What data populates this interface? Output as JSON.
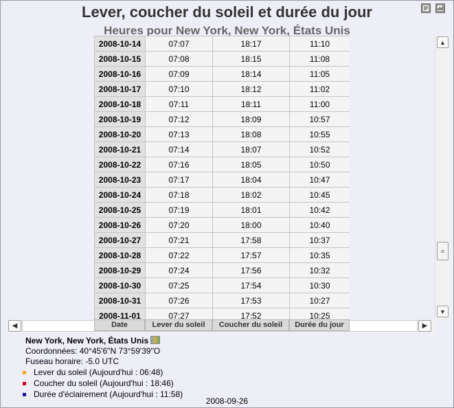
{
  "header": {
    "title": "Lever, coucher du soleil et durée du jour",
    "subtitle": "Heures pour New York, New York, États Unis"
  },
  "toolbar": {
    "icons": [
      "export-icon",
      "chart-icon"
    ]
  },
  "table": {
    "columns": [
      "Date",
      "Lever du soleil",
      "Coucher du soleil",
      "Durée du jour"
    ],
    "rows": [
      [
        "2008-10-14",
        "07:07",
        "18:17",
        "11:10"
      ],
      [
        "2008-10-15",
        "07:08",
        "18:15",
        "11:08"
      ],
      [
        "2008-10-16",
        "07:09",
        "18:14",
        "11:05"
      ],
      [
        "2008-10-17",
        "07:10",
        "18:12",
        "11:02"
      ],
      [
        "2008-10-18",
        "07:11",
        "18:11",
        "11:00"
      ],
      [
        "2008-10-19",
        "07:12",
        "18:09",
        "10:57"
      ],
      [
        "2008-10-20",
        "07:13",
        "18:08",
        "10:55"
      ],
      [
        "2008-10-21",
        "07:14",
        "18:07",
        "10:52"
      ],
      [
        "2008-10-22",
        "07:16",
        "18:05",
        "10:50"
      ],
      [
        "2008-10-23",
        "07:17",
        "18:04",
        "10:47"
      ],
      [
        "2008-10-24",
        "07:18",
        "18:02",
        "10:45"
      ],
      [
        "2008-10-25",
        "07:19",
        "18:01",
        "10:42"
      ],
      [
        "2008-10-26",
        "07:20",
        "18:00",
        "10:40"
      ],
      [
        "2008-10-27",
        "07:21",
        "17:58",
        "10:37"
      ],
      [
        "2008-10-28",
        "07:22",
        "17:57",
        "10:35"
      ],
      [
        "2008-10-29",
        "07:24",
        "17:56",
        "10:32"
      ],
      [
        "2008-10-30",
        "07:25",
        "17:54",
        "10:30"
      ],
      [
        "2008-10-31",
        "07:26",
        "17:53",
        "10:27"
      ],
      [
        "2008-11-01",
        "07:27",
        "17:52",
        "10:25"
      ]
    ]
  },
  "scrollbars": {
    "up_icon": "arrow-up-icon",
    "down_icon": "arrow-down-icon",
    "left_icon": "arrow-left-icon",
    "right_icon": "arrow-right-icon"
  },
  "location": {
    "name": "New York, New York, États Unis",
    "coordinates": "Coordonnées: 40°45'6\"N 73°59'39\"O",
    "timezone": "Fuseau horaire: -5.0 UTC"
  },
  "legend": [
    {
      "label": "Lever du soleil (Aujourd'hui : 06:48)",
      "color": "#f5a623"
    },
    {
      "label": "Coucher du soleil (Aujourd'hui : 18:46)",
      "color": "#d0021b"
    },
    {
      "label": "Durée d'éclairement (Aujourd'hui : 11:58)",
      "color": "#1a1a9c"
    }
  ],
  "footer": {
    "date": "2008-09-26"
  }
}
